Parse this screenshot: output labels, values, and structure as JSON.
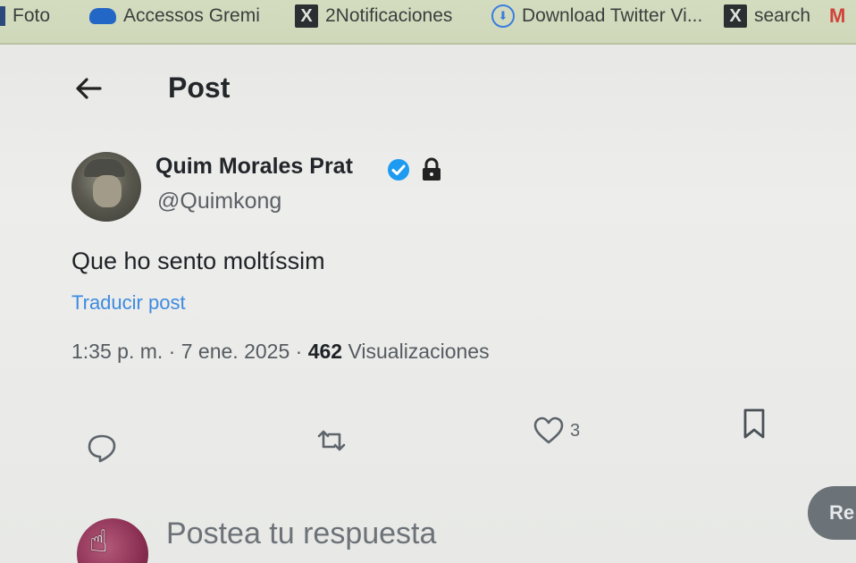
{
  "bookmarks": [
    {
      "label": "Foto",
      "icon": "dark-square-icon"
    },
    {
      "label": "Accessos Gremi",
      "icon": "cloud-icon"
    },
    {
      "label": "2Notificaciones",
      "icon": "x-logo-icon"
    },
    {
      "label": "Download Twitter Vi...",
      "icon": "download-circle-icon"
    },
    {
      "label": "search",
      "icon": "x-logo-icon"
    },
    {
      "label": "M",
      "icon": "gmail-icon"
    }
  ],
  "header": {
    "back_icon": "arrow-left-icon",
    "title": "Post"
  },
  "author": {
    "name": "Quim Morales Prat",
    "handle": "@Quimkong",
    "verified_icon": "verified-badge-icon",
    "lock_icon": "lock-icon",
    "verified_color": "#1d9bf0"
  },
  "post": {
    "text": "Que ho sento moltíssim",
    "translate_label": "Traducir post",
    "time": "1:35 p. m.",
    "separator": "·",
    "date": "7 ene. 2025",
    "views_count": "462",
    "views_label": "Visualizaciones"
  },
  "actions": {
    "reply_icon": "reply-bubble-icon",
    "repost_icon": "repost-icon",
    "like_icon": "heart-icon",
    "like_count": "3",
    "bookmark_icon": "bookmark-icon"
  },
  "composer": {
    "placeholder": "Postea tu respuesta",
    "button_label": "Re"
  },
  "colors": {
    "link": "#3e8be0",
    "bookmarks_bar": "#d4dcc0"
  }
}
